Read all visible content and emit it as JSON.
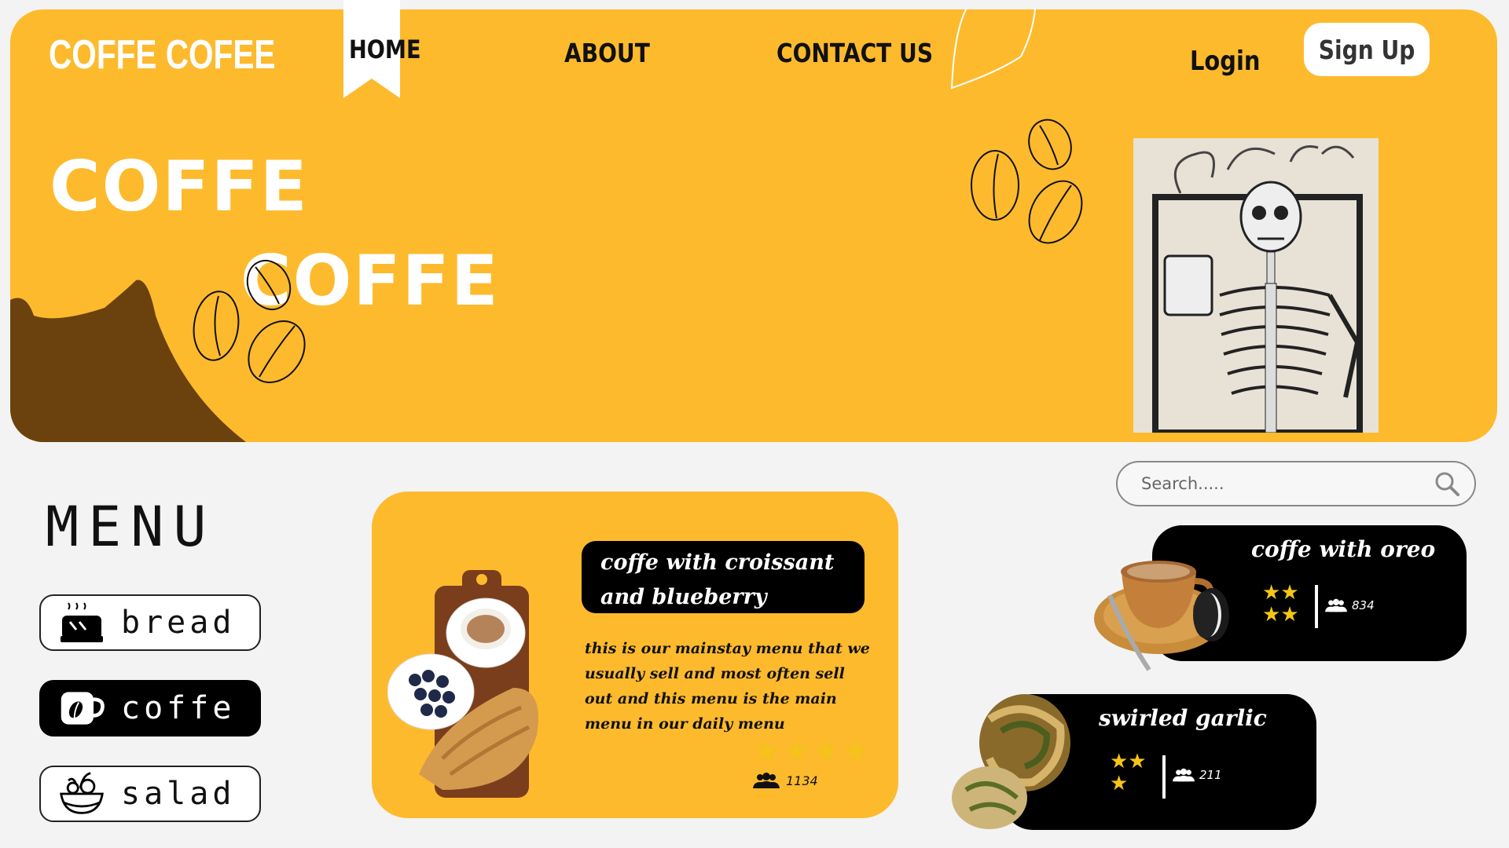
{
  "brand": "COFFE COFEE",
  "nav": {
    "home": "HOME",
    "about": "ABOUT",
    "contact": "CONTACT US"
  },
  "auth": {
    "login": "Login",
    "signup": "Sign Up"
  },
  "hero": {
    "line1": "COFFE",
    "line2": "COFFE"
  },
  "menu": {
    "title": "MENU",
    "categories": [
      {
        "label": "bread",
        "icon": "bread-icon",
        "selected": false
      },
      {
        "label": "coffe",
        "icon": "coffee-cup-icon",
        "selected": true
      },
      {
        "label": "salad",
        "icon": "salad-bowl-icon",
        "selected": false
      }
    ]
  },
  "featured": {
    "title": "coffe with croissant and blueberry",
    "description": "this is our mainstay menu that we usually sell and most often sell out and this menu is the main menu in our daily menu",
    "rating": 4,
    "reviews": "1134"
  },
  "search": {
    "placeholder": "Search....."
  },
  "items": [
    {
      "title": "coffe with oreo",
      "rating": 4,
      "reviews": "834"
    },
    {
      "title": "swirled garlic",
      "rating": 3,
      "reviews": "211"
    }
  ],
  "colors": {
    "accent": "#fdba2d",
    "dark": "#000000",
    "mound": "#6b420e",
    "star": "#f5c518"
  }
}
